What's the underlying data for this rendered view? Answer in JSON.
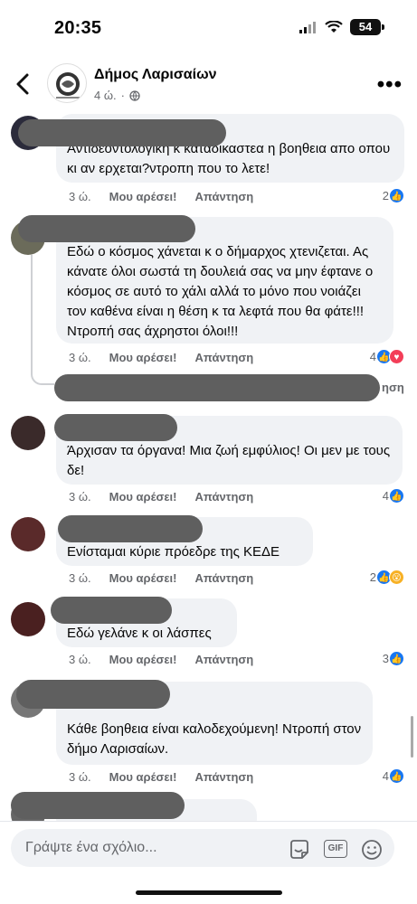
{
  "status_bar": {
    "time": "20:35",
    "battery": "54"
  },
  "header": {
    "page_name": "Δήμος Λαρισαίων",
    "time_ago": "4 ώ.",
    "separator": "·"
  },
  "comments": [
    {
      "text": "Αντιδεοντολογική κ καταδικαστεα η βοηθεια απο οπου κι αν ερχεται?ντροπη που το λετε!",
      "time": "3 ώ.",
      "like_label": "Μου αρέσει!",
      "reply_label": "Απάντηση",
      "reaction_count": "2",
      "reactions": [
        "like"
      ]
    },
    {
      "text": "Εδώ ο κόσμος χάνεται κ ο δήμαρχος χτενιζεται. Ας κάνατε όλοι σωστά τη δουλειά σας να μην έφτανε ο κόσμος σε αυτό το χάλι αλλά το μόνο που νοιάζει τον καθένα είναι η θέση κ τα λεφτά που θα φάτε!!! Ντροπή σας άχρηστοι όλοι!!!",
      "time": "3 ώ.",
      "like_label": "Μου αρέσει!",
      "reply_label": "Απάντηση",
      "reaction_count": "4",
      "reactions": [
        "like",
        "love"
      ],
      "reply_preview_suffix": "ηση"
    },
    {
      "text": "Άρχισαν τα όργανα! Μια ζωή εμφύλιος! Οι μεν με τους δε!",
      "time": "3 ώ.",
      "like_label": "Μου αρέσει!",
      "reply_label": "Απάντηση",
      "reaction_count": "4",
      "reactions": [
        "like"
      ]
    },
    {
      "text": "Ενίσταμαι κύριε πρόεδρε της ΚΕΔΕ",
      "time": "3 ώ.",
      "like_label": "Μου αρέσει!",
      "reply_label": "Απάντηση",
      "reaction_count": "2",
      "reactions": [
        "like",
        "wow"
      ]
    },
    {
      "text": "Εδώ γελάνε κ οι λάσπες",
      "time": "3 ώ.",
      "like_label": "Μου αρέσει!",
      "reply_label": "Απάντηση",
      "reaction_count": "3",
      "reactions": [
        "like"
      ]
    },
    {
      "text": "Κάθε βοηθεια είναι καλοδεχούμενη! Ντροπή στον δήμο Λαρισαίων.",
      "time": "3 ώ.",
      "like_label": "Μου αρέσει!",
      "reply_label": "Απάντηση",
      "reaction_count": "4",
      "reactions": [
        "like"
      ]
    }
  ],
  "composer": {
    "placeholder": "Γράψτε ένα σχόλιο...",
    "gif_label": "GIF"
  }
}
